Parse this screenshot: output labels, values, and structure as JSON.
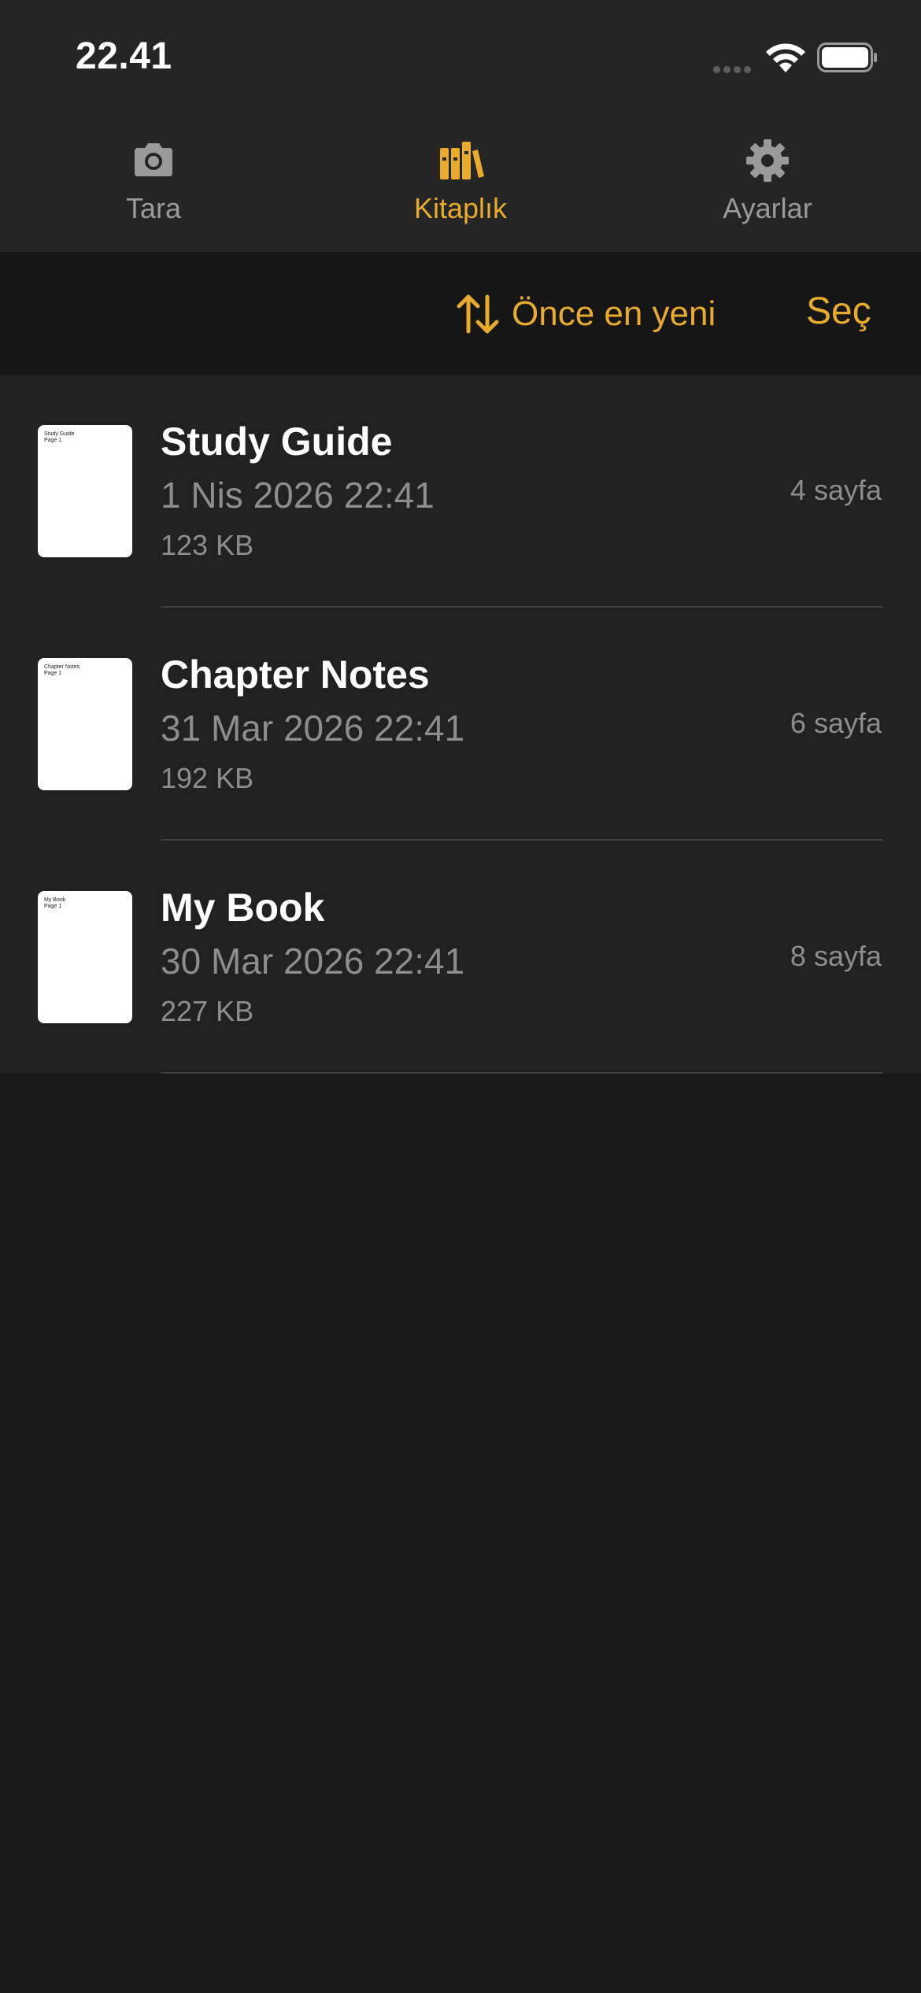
{
  "status_bar": {
    "time": "22.41"
  },
  "tabs": [
    {
      "label": "Tara",
      "icon": "camera-icon",
      "active": false
    },
    {
      "label": "Kitaplık",
      "icon": "books-icon",
      "active": true
    },
    {
      "label": "Ayarlar",
      "icon": "gear-icon",
      "active": false
    }
  ],
  "toolbar": {
    "sort_label": "Önce en yeni",
    "sort_icon": "sort-arrows-icon",
    "select_label": "Seç"
  },
  "documents": [
    {
      "title": "Study Guide",
      "date": "1 Nis 2026 22:41",
      "size": "123 KB",
      "pages": "4 sayfa",
      "thumb_text": "Study Guide\nPage 1"
    },
    {
      "title": "Chapter Notes",
      "date": "31 Mar 2026 22:41",
      "size": "192 KB",
      "pages": "6 sayfa",
      "thumb_text": "Chapter Notes\nPage 1"
    },
    {
      "title": "My Book",
      "date": "30 Mar 2026 22:41",
      "size": "227 KB",
      "pages": "8 sayfa",
      "thumb_text": "My Book\nPage 1"
    }
  ],
  "colors": {
    "accent": "#e8ab2b",
    "background": "#191919",
    "bar_background": "#252525",
    "toolbar_background": "#161616",
    "list_background": "#212121",
    "secondary_text": "#8d8d8d"
  }
}
